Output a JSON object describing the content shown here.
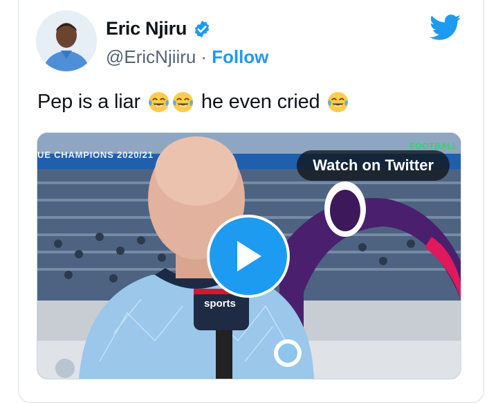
{
  "author": {
    "name": "Eric Njiru",
    "handle": "@EricNjiiru",
    "separator": "·",
    "follow_label": "Follow"
  },
  "tweet": {
    "text_part1": "Pep is a liar",
    "text_part2": "he even cried"
  },
  "media": {
    "watch_label": "Watch on Twitter",
    "banner_text": "UE CHAMPIONS 2020/21",
    "football_tag": "FOOTBALL",
    "mic_brand": "sports"
  },
  "icons": {
    "verified": "verified-badge-icon",
    "logo": "twitter-bird-icon",
    "emoji": "face-with-tears-of-joy-icon",
    "play": "play-icon"
  },
  "colors": {
    "accent": "#1d9bf0",
    "text": "#0f1419",
    "secondary": "#536471"
  }
}
